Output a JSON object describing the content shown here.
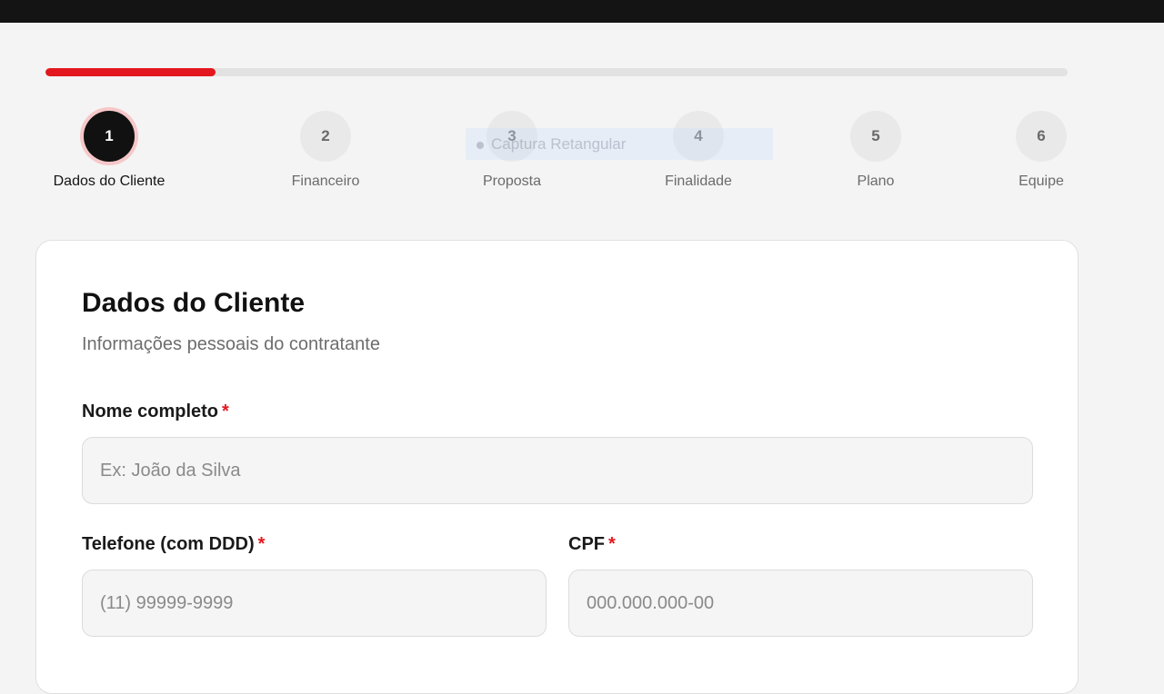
{
  "progress": {
    "fraction": 0.1667,
    "fill_color": "#e3181f"
  },
  "steps": [
    {
      "number": "1",
      "label": "Dados do Cliente",
      "active": true
    },
    {
      "number": "2",
      "label": "Financeiro",
      "active": false
    },
    {
      "number": "3",
      "label": "Proposta",
      "active": false
    },
    {
      "number": "4",
      "label": "Finalidade",
      "active": false
    },
    {
      "number": "5",
      "label": "Plano",
      "active": false
    },
    {
      "number": "6",
      "label": "Equipe",
      "active": false
    }
  ],
  "capture_overlay": {
    "label": "Captura Retangular"
  },
  "form": {
    "title": "Dados do Cliente",
    "subtitle": "Informações pessoais do contratante",
    "required_mark": "*",
    "fields": {
      "name": {
        "label": "Nome completo",
        "placeholder": "Ex: João da Silva",
        "value": ""
      },
      "phone": {
        "label": "Telefone (com DDD)",
        "placeholder": "(11) 99999-9999",
        "value": ""
      },
      "cpf": {
        "label": "CPF",
        "placeholder": "000.000.000-00",
        "value": ""
      }
    }
  }
}
